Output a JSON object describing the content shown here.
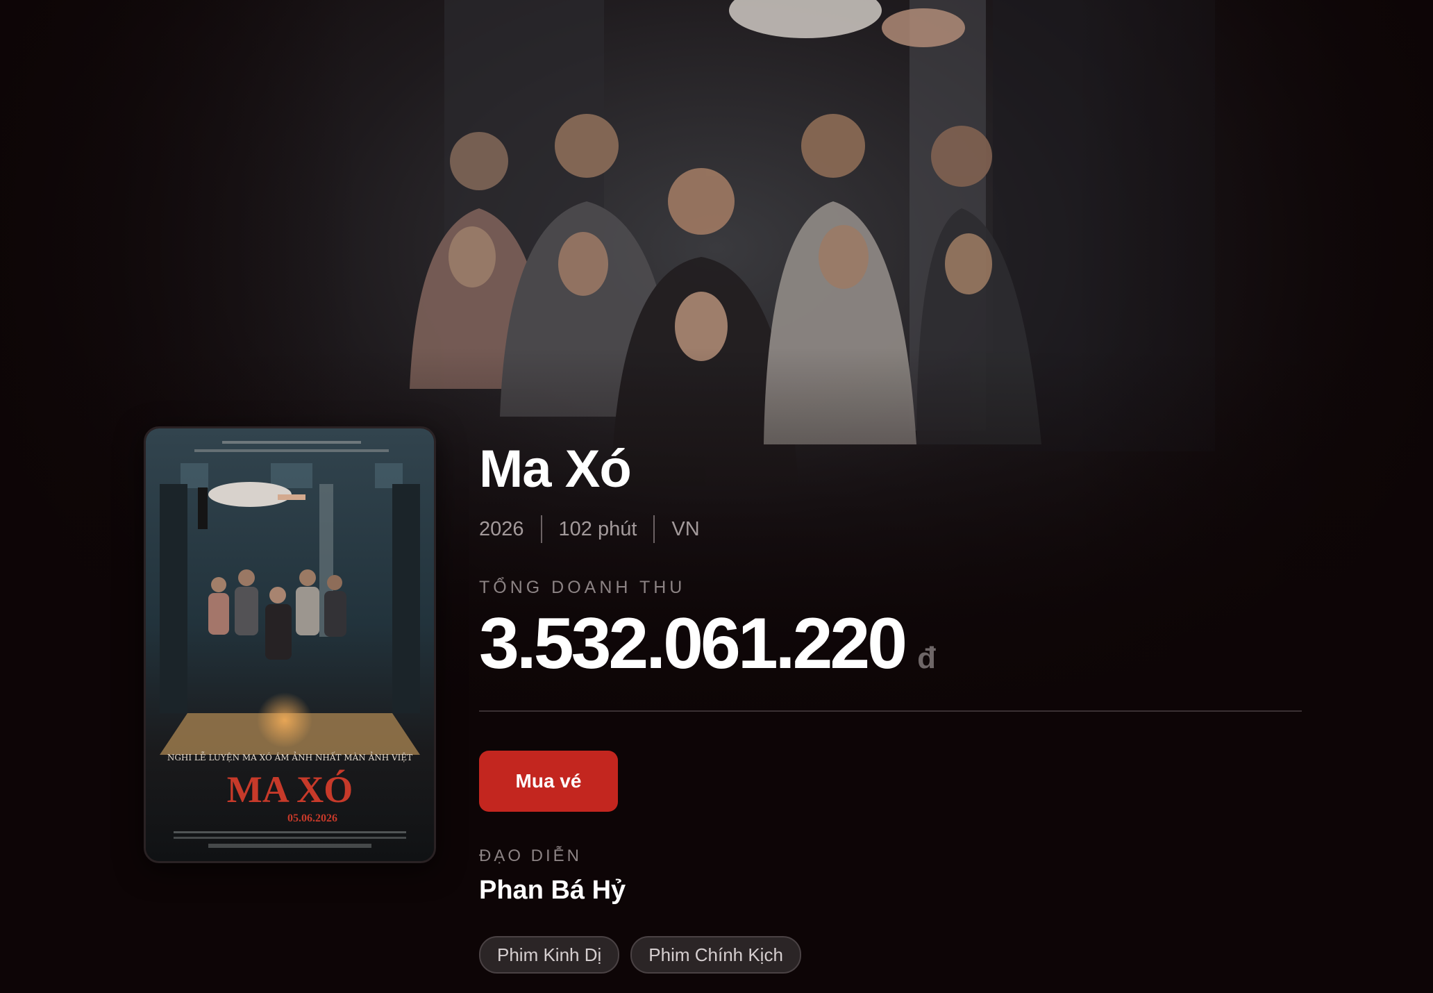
{
  "movie": {
    "title": "Ma Xó",
    "year": "2026",
    "duration": "102 phút",
    "country": "VN",
    "revenue_label": "TỔNG DOANH THU",
    "revenue_amount": "3.532.061.220",
    "revenue_currency": "đ",
    "buy_label": "Mua vé",
    "director_label": "ĐẠO DIỄN",
    "director_name": "Phan Bá Hỷ",
    "genres": [
      "Phim Kinh Dị",
      "Phim Chính Kịch"
    ]
  },
  "poster": {
    "tagline": "NGHI LỄ LUYỆN MA XÓ ÁM ẢNH NHẤT MÀN ẢNH VIỆT",
    "logo_text": "MA XÓ",
    "release_date": "05.06.2026"
  },
  "colors": {
    "accent": "#c3261f",
    "background": "#0d0506",
    "muted_text": "#8c8384"
  }
}
